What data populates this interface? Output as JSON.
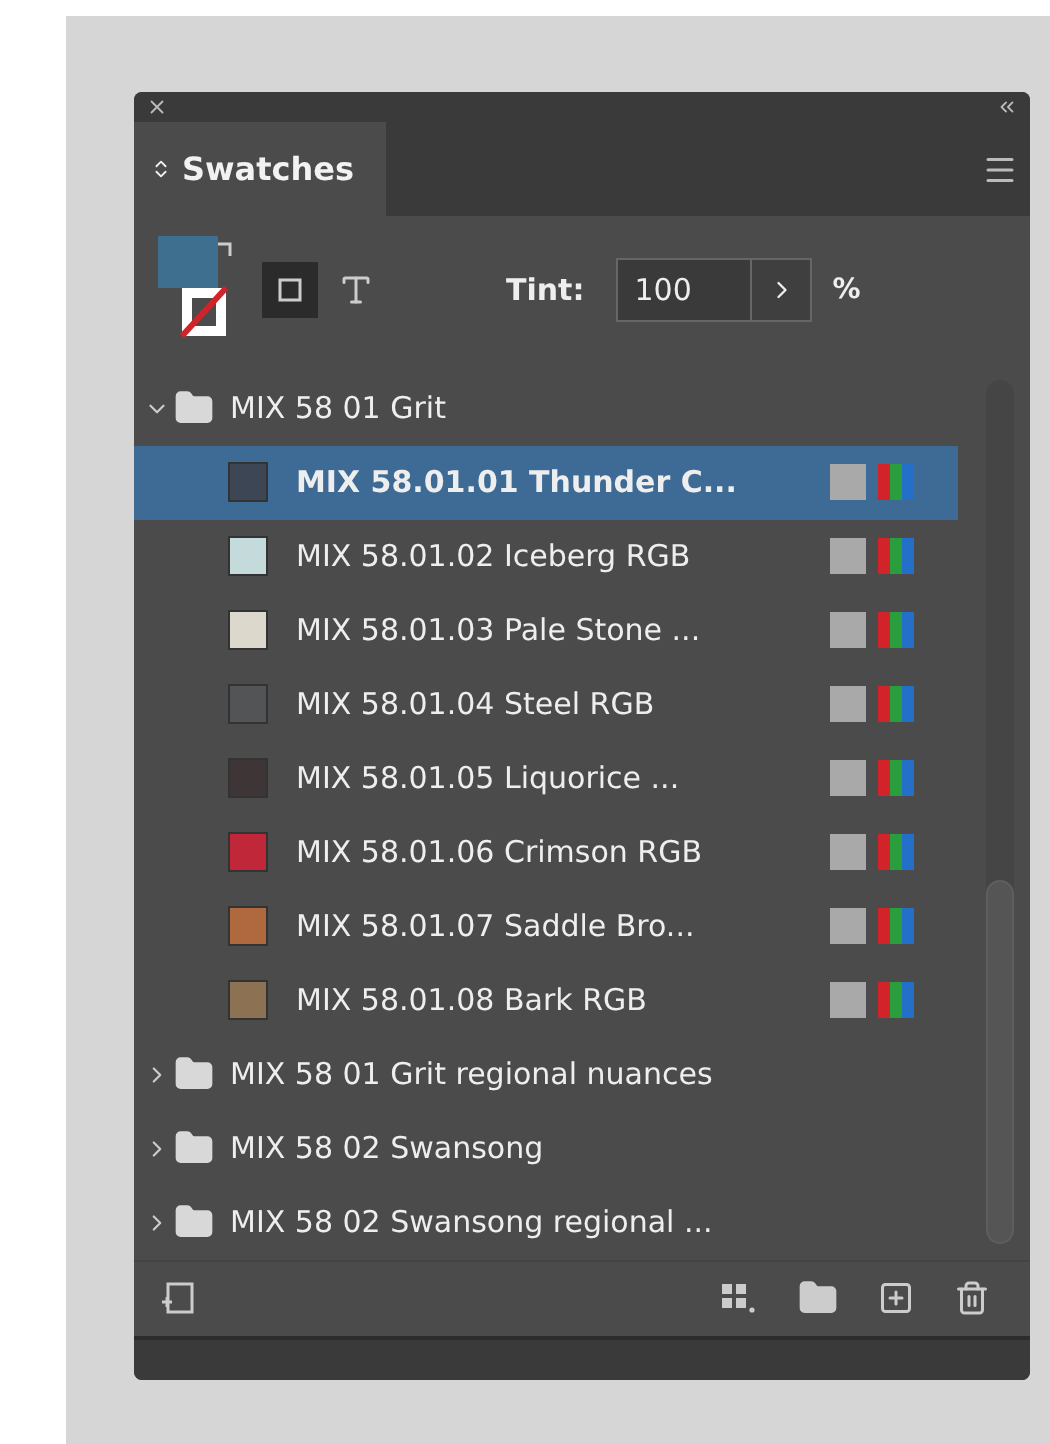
{
  "tabs": [
    {
      "label": "Swatches",
      "selected": true
    }
  ],
  "tint": {
    "label": "Tint:",
    "value": "100",
    "unit": "%"
  },
  "tree": [
    {
      "name": "MIX 58 01 Grit",
      "expanded": true,
      "children": [
        {
          "name": "MIX 58.01.01 Thunder C...",
          "color": "#3d4654",
          "selected": true
        },
        {
          "name": "MIX 58.01.02 Iceberg RGB",
          "color": "#c4dadb",
          "selected": false
        },
        {
          "name": "MIX 58.01.03 Pale Stone ...",
          "color": "#dcd8cb",
          "selected": false
        },
        {
          "name": "MIX 58.01.04 Steel RGB",
          "color": "#535456",
          "selected": false
        },
        {
          "name": "MIX 58.01.05 Liquorice ...",
          "color": "#3e3537",
          "selected": false
        },
        {
          "name": "MIX 58.01.06 Crimson RGB",
          "color": "#c0283a",
          "selected": false
        },
        {
          "name": "MIX 58.01.07 Saddle Bro...",
          "color": "#b0683f",
          "selected": false
        },
        {
          "name": "MIX 58.01.08 Bark RGB",
          "color": "#8c7252",
          "selected": false
        }
      ]
    },
    {
      "name": "MIX 58 01 Grit regional nuances",
      "expanded": false
    },
    {
      "name": "MIX 58 02 Swansong",
      "expanded": false
    },
    {
      "name": "MIX 58 02 Swansong regional ...",
      "expanded": false
    }
  ]
}
